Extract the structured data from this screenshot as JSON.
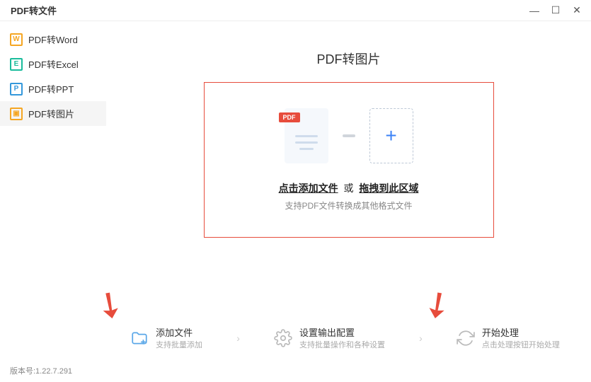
{
  "titlebar": {
    "title": "PDF转文件"
  },
  "sidebar": {
    "items": [
      {
        "label": "PDF转Word",
        "iconLetter": "W"
      },
      {
        "label": "PDF转Excel",
        "iconLetter": "E"
      },
      {
        "label": "PDF转PPT",
        "iconLetter": "P"
      },
      {
        "label": "PDF转图片",
        "iconLetter": "▣"
      }
    ]
  },
  "main": {
    "title": "PDF转图片",
    "pdfBadge": "PDF",
    "dropLine1a": "点击添加文件",
    "dropLine1or": "或",
    "dropLine1b": "拖拽到此区域",
    "dropLine2": "支持PDF文件转换成其他格式文件"
  },
  "steps": {
    "s1_title": "添加文件",
    "s1_sub": "支持批量添加",
    "s2_title": "设置输出配置",
    "s2_sub": "支持批量操作和各种设置",
    "s3_title": "开始处理",
    "s3_sub": "点击处理按钮开始处理",
    "sep": "›"
  },
  "version": "版本号:1.22.7.291"
}
